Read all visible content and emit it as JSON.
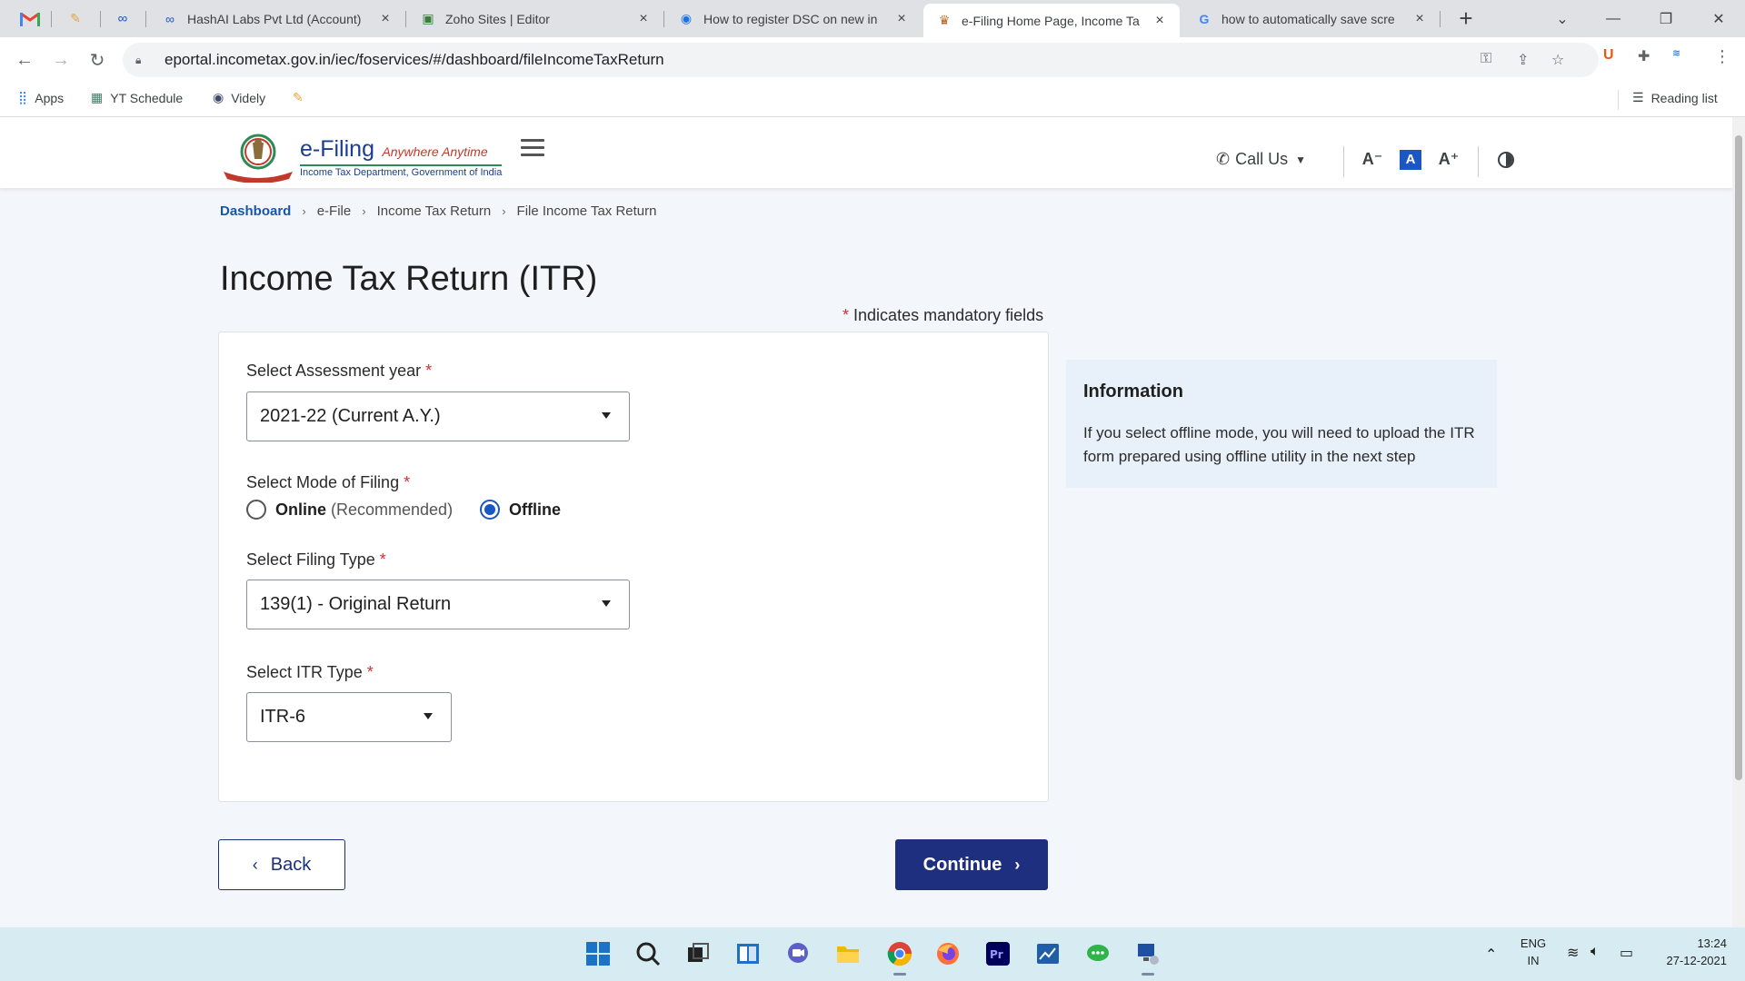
{
  "browser": {
    "tabs": [
      {
        "title": "HashAI Labs Pvt Ltd (Account)",
        "close": "×"
      },
      {
        "title": "Zoho Sites | Editor",
        "close": "×"
      },
      {
        "title": "How to register DSC on new in",
        "close": "×"
      },
      {
        "title": "e-Filing Home Page, Income Ta",
        "close": "×"
      },
      {
        "title": "how to automatically save scre",
        "close": "×"
      }
    ],
    "new_tab": "+",
    "url": "eportal.incometax.gov.in/iec/foservices/#/dashboard/fileIncomeTaxReturn",
    "bookmarks": [
      {
        "label": "Apps"
      },
      {
        "label": "YT Schedule"
      },
      {
        "label": "Videly"
      }
    ],
    "reading_list": "Reading list"
  },
  "header": {
    "logo_main": "e-Filing",
    "logo_tagline": "Anywhere Anytime",
    "logo_sub": "Income Tax Department, Government of India",
    "call_us": "Call Us",
    "font_decrease": "A⁻",
    "font_normal": "A",
    "font_increase": "A⁺"
  },
  "breadcrumb": [
    "Dashboard",
    "e-File",
    "Income Tax Return",
    "File Income Tax Return"
  ],
  "page": {
    "title": "Income Tax Return (ITR)",
    "mandatory_star": "*",
    "mandatory_note": "Indicates mandatory fields"
  },
  "form": {
    "assessment_year_label": "Select Assessment year",
    "assessment_year_value": "2021-22  (Current A.Y.)",
    "mode_label": "Select Mode of Filing",
    "mode_online": "Online",
    "mode_online_note": "(Recommended)",
    "mode_offline": "Offline",
    "mode_selected": "Offline",
    "filing_type_label": "Select Filing Type",
    "filing_type_value": "139(1) - Original Return",
    "itr_type_label": "Select ITR Type",
    "itr_type_value": "ITR-6",
    "required_mark": "*"
  },
  "info": {
    "title": "Information",
    "body": "If you select offline mode, you will need to upload the ITR form prepared using offline utility in the next step"
  },
  "actions": {
    "back": "Back",
    "continue": "Continue"
  },
  "taskbar": {
    "lang_top": "ENG",
    "lang_bottom": "IN",
    "time": "13:24",
    "date": "27-12-2021"
  },
  "colors": {
    "primary_button": "#1f2f80",
    "radio_selected": "#1a56c4",
    "required": "#d32f2f",
    "info_bg": "#e8f0fa"
  }
}
